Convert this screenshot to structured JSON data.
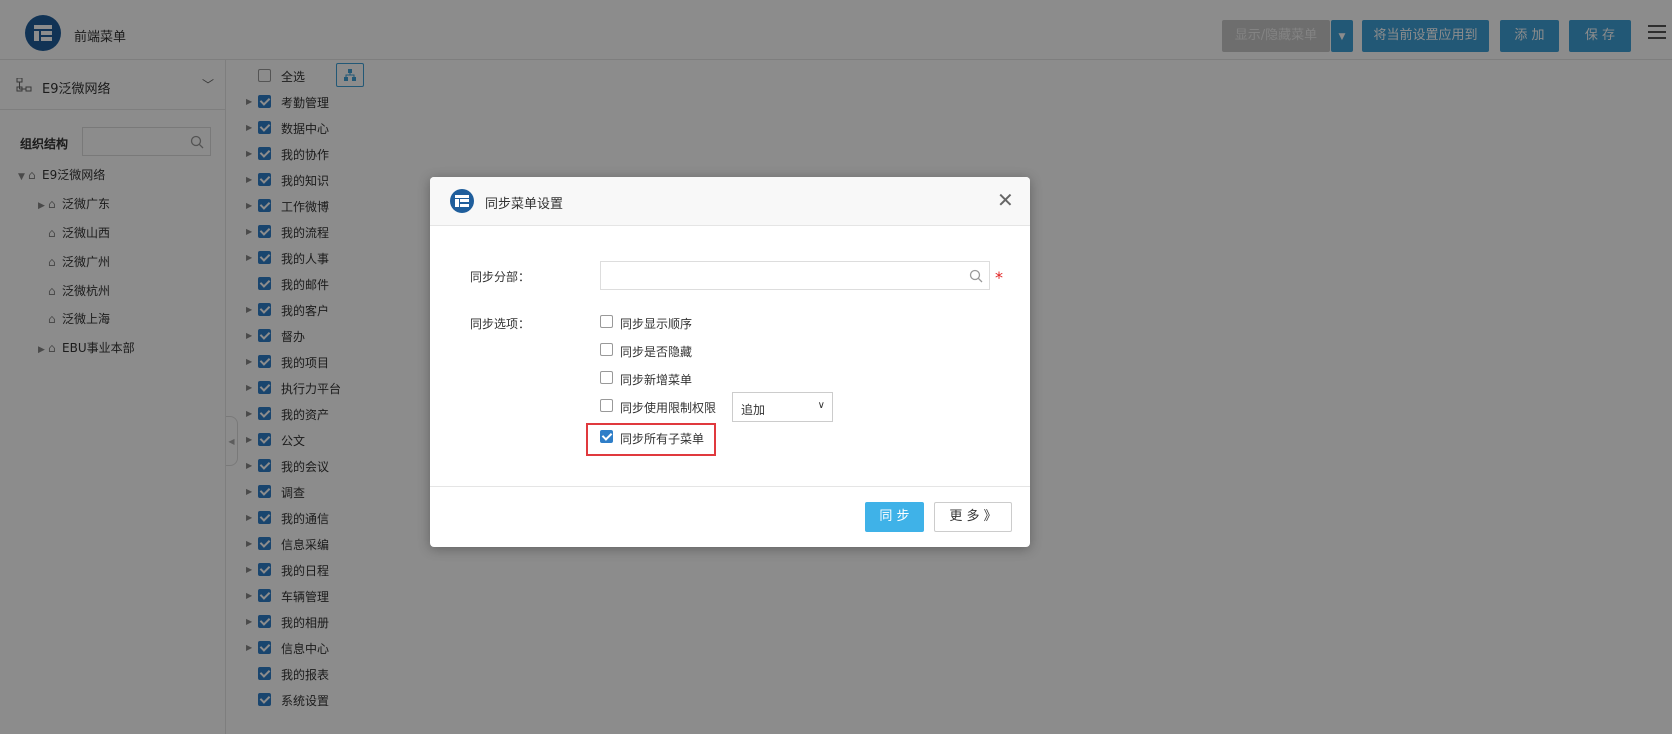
{
  "header": {
    "title": "前端菜单",
    "buttons": {
      "show_hide": "显示/隐藏菜单",
      "apply": "将当前设置应用到",
      "add": "添 加",
      "save": "保 存"
    }
  },
  "sidebar": {
    "org_selected": "E9泛微网络",
    "tree_label": "组织结构",
    "search_placeholder": "",
    "tree": [
      {
        "label": "E9泛微网络",
        "level": 0,
        "expanded": true
      },
      {
        "label": "泛微广东",
        "level": 1,
        "expandable": true
      },
      {
        "label": "泛微山西",
        "level": 1,
        "expandable": false
      },
      {
        "label": "泛微广州",
        "level": 1,
        "expandable": false
      },
      {
        "label": "泛微杭州",
        "level": 1,
        "expandable": false
      },
      {
        "label": "泛微上海",
        "level": 1,
        "expandable": false
      },
      {
        "label": "EBU事业本部",
        "level": 1,
        "expandable": true
      }
    ]
  },
  "menu": {
    "select_all": "全选",
    "items": [
      {
        "label": "考勤管理",
        "checked": true,
        "expandable": true
      },
      {
        "label": "数据中心",
        "checked": true,
        "expandable": true
      },
      {
        "label": "我的协作",
        "checked": true,
        "expandable": true
      },
      {
        "label": "我的知识",
        "checked": true,
        "expandable": true
      },
      {
        "label": "工作微博",
        "checked": true,
        "expandable": true
      },
      {
        "label": "我的流程",
        "checked": true,
        "expandable": true
      },
      {
        "label": "我的人事",
        "checked": true,
        "expandable": true
      },
      {
        "label": "我的邮件",
        "checked": true,
        "expandable": false
      },
      {
        "label": "我的客户",
        "checked": true,
        "expandable": true
      },
      {
        "label": "督办",
        "checked": true,
        "expandable": true
      },
      {
        "label": "我的项目",
        "checked": true,
        "expandable": true
      },
      {
        "label": "执行力平台",
        "checked": true,
        "expandable": true
      },
      {
        "label": "我的资产",
        "checked": true,
        "expandable": true
      },
      {
        "label": "公文",
        "checked": true,
        "expandable": true
      },
      {
        "label": "我的会议",
        "checked": true,
        "expandable": true
      },
      {
        "label": "调查",
        "checked": true,
        "expandable": true
      },
      {
        "label": "我的通信",
        "checked": true,
        "expandable": true
      },
      {
        "label": "信息采编",
        "checked": true,
        "expandable": true
      },
      {
        "label": "我的日程",
        "checked": true,
        "expandable": true
      },
      {
        "label": "车辆管理",
        "checked": true,
        "expandable": true
      },
      {
        "label": "我的相册",
        "checked": true,
        "expandable": true
      },
      {
        "label": "信息中心",
        "checked": true,
        "expandable": true
      },
      {
        "label": "我的报表",
        "checked": true,
        "expandable": false
      },
      {
        "label": "系统设置",
        "checked": true,
        "expandable": false
      }
    ]
  },
  "dialog": {
    "title": "同步菜单设置",
    "dept_label": "同步分部：",
    "dept_value": "",
    "required_mark": "*",
    "options_label": "同步选项：",
    "options": [
      {
        "label": "同步显示顺序",
        "checked": false
      },
      {
        "label": "同步是否隐藏",
        "checked": false
      },
      {
        "label": "同步新增菜单",
        "checked": false
      },
      {
        "label": "同步使用限制权限",
        "checked": false
      },
      {
        "label": "同步所有子菜单",
        "checked": true
      }
    ],
    "permission_mode": "追加",
    "sync_button": "同 步",
    "more_button": "更 多 》"
  },
  "colors": {
    "primary": "#3fa1d8",
    "logo": "#1f5e9c",
    "checkbox": "#2f7ec8",
    "highlight": "#e0393e",
    "required": "#e02020"
  }
}
